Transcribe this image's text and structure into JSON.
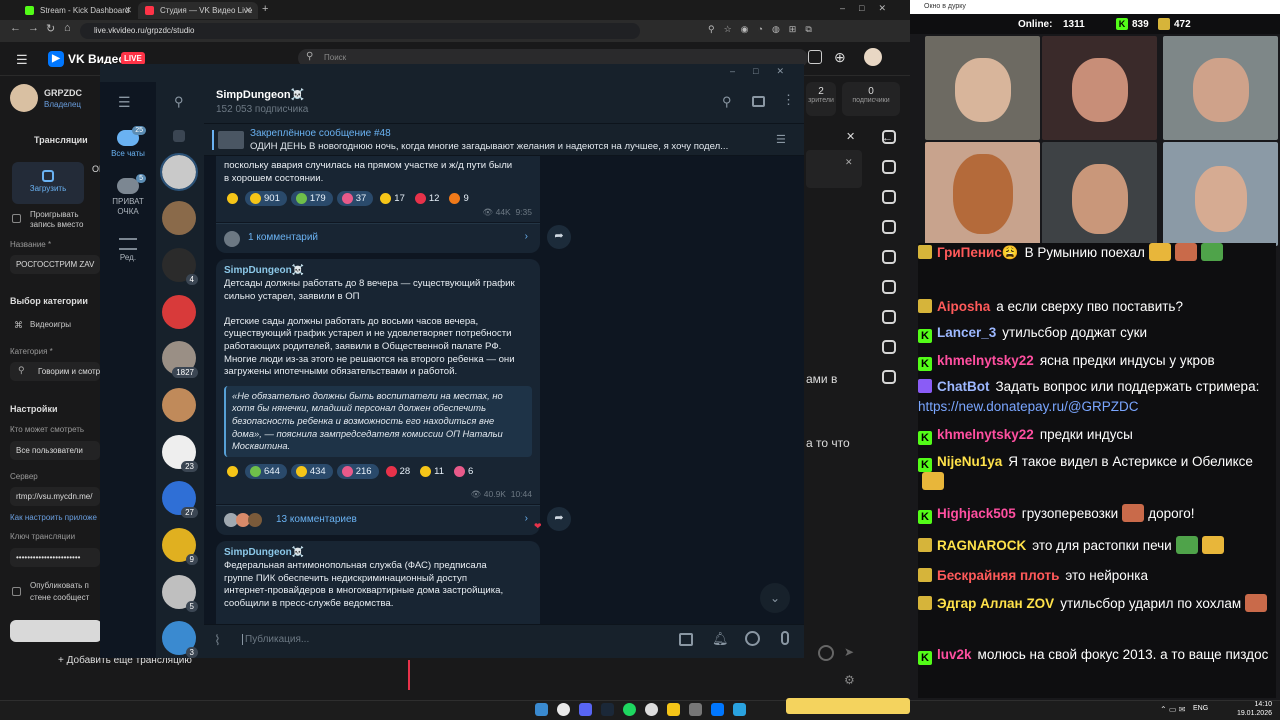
{
  "browser": {
    "tabs": [
      {
        "title": "Stream - Kick Dashboard",
        "color": "#53fc18"
      },
      {
        "title": "Студия — VK Видео Live",
        "color": "#ff3347"
      }
    ],
    "url": "live.vkvideo.ru/grpzdc/studio"
  },
  "studio": {
    "brand": "VK Видео",
    "live_badge": "LIVE",
    "search_placeholder": "Поиск",
    "channel": {
      "name": "GRPZDC",
      "role": "Владелец"
    },
    "tab_broadcasts": "Трансляции",
    "upload_label": "Загрузить",
    "side_text_top": "ОБ",
    "loop_label": "Проигрывать запись вместо обложки",
    "title_label": "Название *",
    "title_value": "РОСГОССТРИМ ZAV",
    "category_section": "Выбор категории",
    "category_videogames": "Видеоигры",
    "category_label": "Категория *",
    "category_value": "Говорим и смотр",
    "settings_section": "Настройки",
    "who_can_watch_label": "Кто может смотреть",
    "who_can_watch_value": "Все пользователи",
    "server_label": "Сервер",
    "server_value": "rtmp://vsu.mycdn.me/",
    "how_to_setup": "Как настроить приложе",
    "stream_key_label": "Ключ трансляции",
    "stream_key_value": "•••••••••••••••••••••••",
    "publish_label": "Опубликовать п стене сообщест",
    "add_stream": "+ Добавить еще трансляцию",
    "stats": [
      {
        "value": "2",
        "label": "зрители"
      },
      {
        "value": "0",
        "label": "подписчики"
      }
    ],
    "right_fragments": [
      "ами в",
      "а то что"
    ]
  },
  "telegram": {
    "folders": [
      {
        "label": "Все чаты",
        "badge": "25",
        "active": true
      },
      {
        "label": "ПРИВАТ ОЧКА",
        "badge": "5",
        "active": false
      },
      {
        "label": "Ред.",
        "badge": "",
        "active": false
      }
    ],
    "chat_avatars": [
      {
        "badge": "",
        "color": "#c9c9c9"
      },
      {
        "badge": "",
        "color": "#8a6a4a"
      },
      {
        "badge": "4",
        "color": "#2b2b2b"
      },
      {
        "badge": "",
        "color": "#d83a3a"
      },
      {
        "badge": "1827",
        "color": "#9a8f85"
      },
      {
        "badge": "",
        "color": "#c08a5a"
      },
      {
        "badge": "23",
        "color": "#eeeeee"
      },
      {
        "badge": "27",
        "color": "#2f6fd6"
      },
      {
        "badge": "9",
        "color": "#e0b020"
      },
      {
        "badge": "5",
        "color": "#bfbfbf"
      },
      {
        "badge": "3",
        "color": "#3a8ad0"
      }
    ],
    "channel_title": "SimpDungeon☠️",
    "channel_subs": "152 053 подписчика",
    "pinned_title": "Закреплённое сообщение #48",
    "pinned_text": "ОДИН ДЕНЬ  В новогоднюю ночь, когда многие загадывают желания и надеются на лучшее, я хочу подел...",
    "messages": [
      {
        "text": "поскольку авария случилась на прямом участке и ж/д пути были\nв хорошем состоянии.",
        "reactions": [
          {
            "count": "",
            "emoji": "star",
            "color": "#f5c518"
          },
          {
            "count": "901",
            "emoji": "sad",
            "color": "#f5c518"
          },
          {
            "count": "179",
            "emoji": "money",
            "color": "#6fbf4a"
          },
          {
            "count": "37",
            "emoji": "clown",
            "color": "#e85a8a"
          },
          {
            "count": "17",
            "emoji": "thumb",
            "color": "#f5c518"
          },
          {
            "count": "12",
            "emoji": "heart",
            "color": "#e8324a"
          },
          {
            "count": "9",
            "emoji": "fire",
            "color": "#f07a1a"
          }
        ],
        "views": "44K",
        "time": "9:35",
        "comments": "1 комментарий"
      },
      {
        "sender": "SimpDungeon☠️",
        "text": "Детсады должны работать до 8 вечера — существующий график\nсильно устарел, заявили в ОП\n\nДетские сады должны работать до восьми часов вечера,\nсуществующий график устарел и не удовлетворяет потребности\nработающих родителей, заявили в Общественной палате РФ.\nМногие люди из-за этого не решаются на второго ребенка — они\nзагружены ипотечными обязательствами и работой.",
        "quote": "«Не обязательно должны быть воспитатели на местах, но хотя бы нянечки, младший персонал должен обеспечить безопасность ребенка и возможность его находиться вне дома», — пояснила зампредседателя комиссии ОП Натальи Москвитина.",
        "reactions": [
          {
            "count": "",
            "emoji": "star",
            "color": "#f5c518"
          },
          {
            "count": "644",
            "emoji": "money",
            "color": "#6fbf4a"
          },
          {
            "count": "434",
            "emoji": "thumb",
            "color": "#f5c518"
          },
          {
            "count": "216",
            "emoji": "clown",
            "color": "#e85a8a"
          },
          {
            "count": "28",
            "emoji": "heart",
            "color": "#e8324a"
          },
          {
            "count": "11",
            "emoji": "sad",
            "color": "#f5c518"
          },
          {
            "count": "6",
            "emoji": "clown",
            "color": "#e85a8a"
          }
        ],
        "views": "40.9K",
        "time": "10:44",
        "comments": "13 комментариев"
      },
      {
        "sender": "SimpDungeon☠️",
        "text": "Федеральная антимонопольная служба (ФАС) предписала\nгруппе ПИК обеспечить недискриминационный доступ\nинтернет-провайдеров в многоквартирные дома застройщика,\nсообщили в пресс-службе ведомства."
      }
    ],
    "input_placeholder": "Публикация..."
  },
  "stream": {
    "window_title": "Окно в дурку",
    "online_label": "Online:",
    "online_count": "1311",
    "kick_count": "839",
    "vk_count": "472",
    "chat": [
      {
        "badge": "sub",
        "name": "ГриПенис😩",
        "name_color": "#ff5a5a",
        "text": "В Румынию поехал",
        "emotes": 3
      },
      {
        "badge": "sub",
        "name": "Aiposha",
        "name_color": "#ff5a5a",
        "text": "а если сверху пво поставить?",
        "emotes": 0
      },
      {
        "badge": "kick",
        "name": "Lancer_3",
        "name_color": "#9db8ff",
        "text": "утильсбор доджат суки",
        "emotes": 0
      },
      {
        "badge": "kick",
        "name": "khmelnytsky22",
        "name_color": "#ff4fa0",
        "text": "ясна предки индусы у укров",
        "emotes": 0
      },
      {
        "badge": "bot",
        "name": "ChatBot",
        "name_color": "#9db8ff",
        "text": "Задать вопрос или поддержать стримера: ",
        "link": "https://new.donatepay.ru/@GRPZDC",
        "emotes": 0
      },
      {
        "badge": "kick",
        "name": "khmelnytsky22",
        "name_color": "#ff4fa0",
        "text": "предки индусы",
        "emotes": 0
      },
      {
        "badge": "kick",
        "name": "NijeNu1ya",
        "name_color": "#ffe24a",
        "text": "Я такое видел в Астериксе и Обеликсе",
        "emotes": 1
      },
      {
        "badge": "kick",
        "name": "Highjack505",
        "name_color": "#ff4fa0",
        "text": "грузоперевозки",
        "text2": "дорого!",
        "emotes": 1
      },
      {
        "badge": "sub",
        "name": "RAGNAROCK",
        "name_color": "#ffe24a",
        "text": "это для растопки печи",
        "emotes": 2
      },
      {
        "badge": "sub",
        "name": "Бескрайняя плоть",
        "name_color": "#ff5a5a",
        "text": "это нейронка",
        "emotes": 0
      },
      {
        "badge": "sub",
        "name": "Эдгар Аллан ZOV",
        "name_color": "#ffe24a",
        "text": "утильсбор ударил по хохлам",
        "emotes": 1
      },
      {
        "badge": "kick",
        "name": "luv2k",
        "name_color": "#ff4fa0",
        "text": "молюсь на свой фокус 2013. а то ваще пиздос",
        "emotes": 0
      }
    ]
  },
  "taskbar": {
    "lang": "ENG",
    "time": "14:10",
    "date": "19.01.2026"
  }
}
